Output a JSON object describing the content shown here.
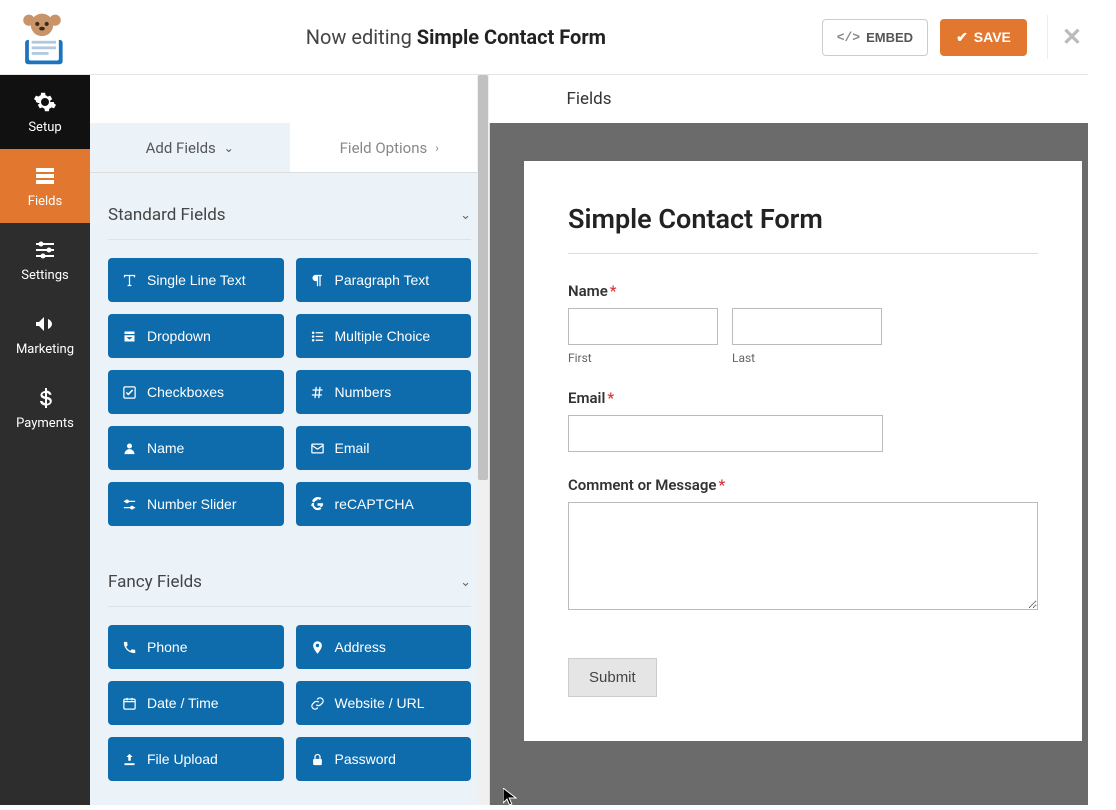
{
  "topbar": {
    "editing_prefix": "Now editing ",
    "form_name": "Simple Contact Form",
    "embed_label": "EMBED",
    "save_label": "SAVE"
  },
  "section_title": "Fields",
  "sidebar": {
    "items": [
      {
        "label": "Setup"
      },
      {
        "label": "Fields"
      },
      {
        "label": "Settings"
      },
      {
        "label": "Marketing"
      },
      {
        "label": "Payments"
      }
    ]
  },
  "panel": {
    "tabs": {
      "add_fields": "Add Fields",
      "field_options": "Field Options"
    },
    "sections": [
      {
        "title": "Standard Fields",
        "fields": [
          {
            "label": "Single Line Text",
            "icon": "text"
          },
          {
            "label": "Paragraph Text",
            "icon": "paragraph"
          },
          {
            "label": "Dropdown",
            "icon": "dropdown"
          },
          {
            "label": "Multiple Choice",
            "icon": "list"
          },
          {
            "label": "Checkboxes",
            "icon": "check"
          },
          {
            "label": "Numbers",
            "icon": "hash"
          },
          {
            "label": "Name",
            "icon": "user"
          },
          {
            "label": "Email",
            "icon": "mail"
          },
          {
            "label": "Number Slider",
            "icon": "slider"
          },
          {
            "label": "reCAPTCHA",
            "icon": "google"
          }
        ]
      },
      {
        "title": "Fancy Fields",
        "fields": [
          {
            "label": "Phone",
            "icon": "phone"
          },
          {
            "label": "Address",
            "icon": "pin"
          },
          {
            "label": "Date / Time",
            "icon": "calendar"
          },
          {
            "label": "Website / URL",
            "icon": "link"
          },
          {
            "label": "File Upload",
            "icon": "upload"
          },
          {
            "label": "Password",
            "icon": "lock"
          }
        ]
      }
    ]
  },
  "preview": {
    "form_title": "Simple Contact Form",
    "name_label": "Name",
    "first_sublabel": "First",
    "last_sublabel": "Last",
    "email_label": "Email",
    "comment_label": "Comment or Message",
    "submit_label": "Submit"
  }
}
